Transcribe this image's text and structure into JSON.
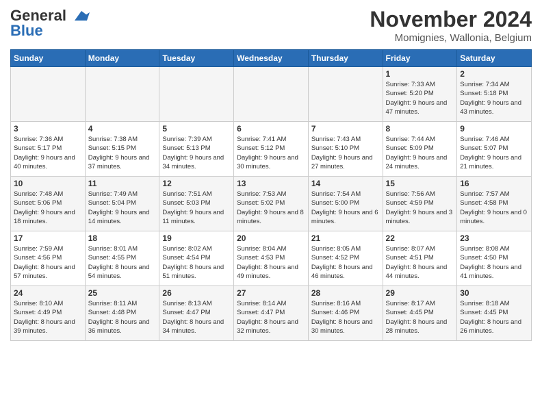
{
  "logo": {
    "general": "General",
    "blue": "Blue"
  },
  "title": "November 2024",
  "location": "Momignies, Wallonia, Belgium",
  "days_of_week": [
    "Sunday",
    "Monday",
    "Tuesday",
    "Wednesday",
    "Thursday",
    "Friday",
    "Saturday"
  ],
  "weeks": [
    [
      {
        "day": "",
        "info": ""
      },
      {
        "day": "",
        "info": ""
      },
      {
        "day": "",
        "info": ""
      },
      {
        "day": "",
        "info": ""
      },
      {
        "day": "",
        "info": ""
      },
      {
        "day": "1",
        "info": "Sunrise: 7:33 AM\nSunset: 5:20 PM\nDaylight: 9 hours and 47 minutes."
      },
      {
        "day": "2",
        "info": "Sunrise: 7:34 AM\nSunset: 5:18 PM\nDaylight: 9 hours and 43 minutes."
      }
    ],
    [
      {
        "day": "3",
        "info": "Sunrise: 7:36 AM\nSunset: 5:17 PM\nDaylight: 9 hours and 40 minutes."
      },
      {
        "day": "4",
        "info": "Sunrise: 7:38 AM\nSunset: 5:15 PM\nDaylight: 9 hours and 37 minutes."
      },
      {
        "day": "5",
        "info": "Sunrise: 7:39 AM\nSunset: 5:13 PM\nDaylight: 9 hours and 34 minutes."
      },
      {
        "day": "6",
        "info": "Sunrise: 7:41 AM\nSunset: 5:12 PM\nDaylight: 9 hours and 30 minutes."
      },
      {
        "day": "7",
        "info": "Sunrise: 7:43 AM\nSunset: 5:10 PM\nDaylight: 9 hours and 27 minutes."
      },
      {
        "day": "8",
        "info": "Sunrise: 7:44 AM\nSunset: 5:09 PM\nDaylight: 9 hours and 24 minutes."
      },
      {
        "day": "9",
        "info": "Sunrise: 7:46 AM\nSunset: 5:07 PM\nDaylight: 9 hours and 21 minutes."
      }
    ],
    [
      {
        "day": "10",
        "info": "Sunrise: 7:48 AM\nSunset: 5:06 PM\nDaylight: 9 hours and 18 minutes."
      },
      {
        "day": "11",
        "info": "Sunrise: 7:49 AM\nSunset: 5:04 PM\nDaylight: 9 hours and 14 minutes."
      },
      {
        "day": "12",
        "info": "Sunrise: 7:51 AM\nSunset: 5:03 PM\nDaylight: 9 hours and 11 minutes."
      },
      {
        "day": "13",
        "info": "Sunrise: 7:53 AM\nSunset: 5:02 PM\nDaylight: 9 hours and 8 minutes."
      },
      {
        "day": "14",
        "info": "Sunrise: 7:54 AM\nSunset: 5:00 PM\nDaylight: 9 hours and 6 minutes."
      },
      {
        "day": "15",
        "info": "Sunrise: 7:56 AM\nSunset: 4:59 PM\nDaylight: 9 hours and 3 minutes."
      },
      {
        "day": "16",
        "info": "Sunrise: 7:57 AM\nSunset: 4:58 PM\nDaylight: 9 hours and 0 minutes."
      }
    ],
    [
      {
        "day": "17",
        "info": "Sunrise: 7:59 AM\nSunset: 4:56 PM\nDaylight: 8 hours and 57 minutes."
      },
      {
        "day": "18",
        "info": "Sunrise: 8:01 AM\nSunset: 4:55 PM\nDaylight: 8 hours and 54 minutes."
      },
      {
        "day": "19",
        "info": "Sunrise: 8:02 AM\nSunset: 4:54 PM\nDaylight: 8 hours and 51 minutes."
      },
      {
        "day": "20",
        "info": "Sunrise: 8:04 AM\nSunset: 4:53 PM\nDaylight: 8 hours and 49 minutes."
      },
      {
        "day": "21",
        "info": "Sunrise: 8:05 AM\nSunset: 4:52 PM\nDaylight: 8 hours and 46 minutes."
      },
      {
        "day": "22",
        "info": "Sunrise: 8:07 AM\nSunset: 4:51 PM\nDaylight: 8 hours and 44 minutes."
      },
      {
        "day": "23",
        "info": "Sunrise: 8:08 AM\nSunset: 4:50 PM\nDaylight: 8 hours and 41 minutes."
      }
    ],
    [
      {
        "day": "24",
        "info": "Sunrise: 8:10 AM\nSunset: 4:49 PM\nDaylight: 8 hours and 39 minutes."
      },
      {
        "day": "25",
        "info": "Sunrise: 8:11 AM\nSunset: 4:48 PM\nDaylight: 8 hours and 36 minutes."
      },
      {
        "day": "26",
        "info": "Sunrise: 8:13 AM\nSunset: 4:47 PM\nDaylight: 8 hours and 34 minutes."
      },
      {
        "day": "27",
        "info": "Sunrise: 8:14 AM\nSunset: 4:47 PM\nDaylight: 8 hours and 32 minutes."
      },
      {
        "day": "28",
        "info": "Sunrise: 8:16 AM\nSunset: 4:46 PM\nDaylight: 8 hours and 30 minutes."
      },
      {
        "day": "29",
        "info": "Sunrise: 8:17 AM\nSunset: 4:45 PM\nDaylight: 8 hours and 28 minutes."
      },
      {
        "day": "30",
        "info": "Sunrise: 8:18 AM\nSunset: 4:45 PM\nDaylight: 8 hours and 26 minutes."
      }
    ]
  ]
}
